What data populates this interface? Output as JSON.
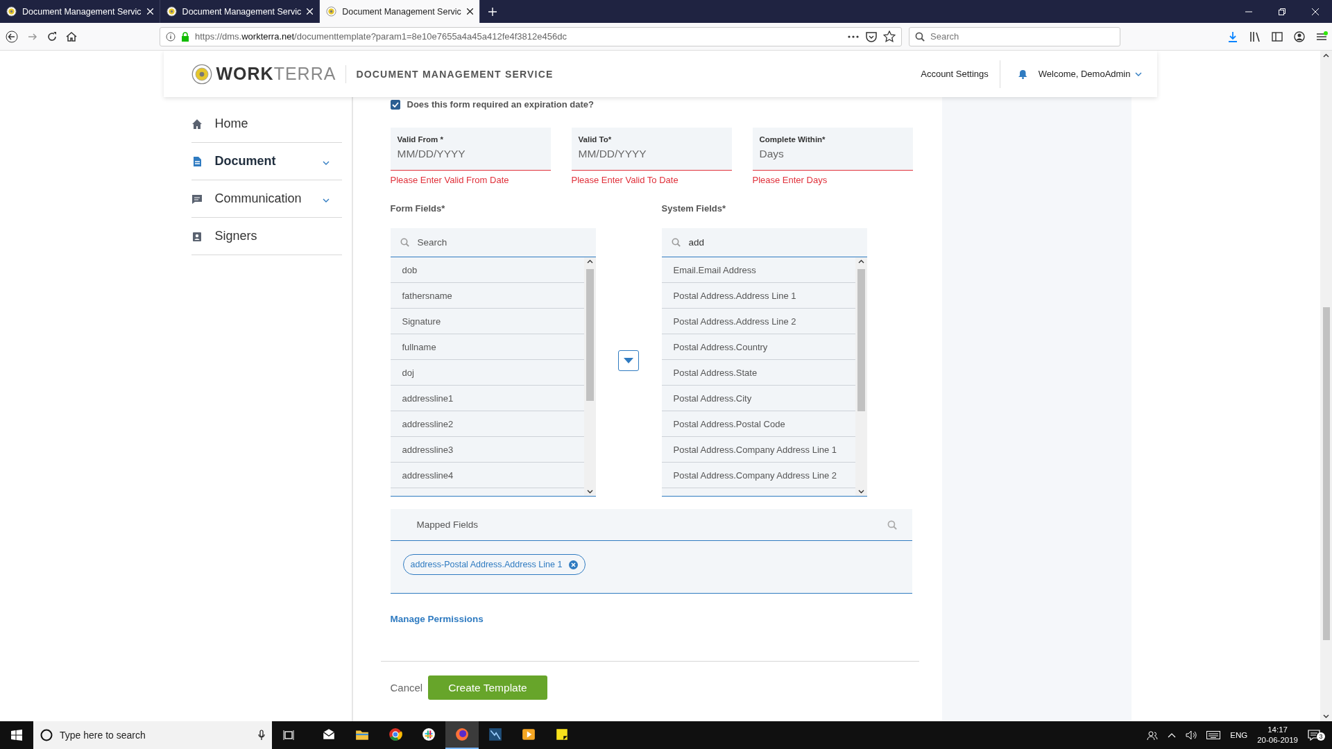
{
  "browser": {
    "tabs": [
      {
        "title": "Document Management Servic",
        "selected": false
      },
      {
        "title": "Document Management Servic",
        "selected": false
      },
      {
        "title": "Document Management Servic",
        "selected": true
      }
    ],
    "url_prefix": "https://dms.",
    "url_domain": "workterra.net",
    "url_path": "/documenttemplate?param1=8e10e7655a4a45a412fe4f3812e456dc",
    "search": {
      "placeholder": "Search"
    }
  },
  "header": {
    "logo_bold": "WORK",
    "logo_light": "TERRA",
    "service": "DOCUMENT MANAGEMENT SERVICE",
    "account_settings": "Account Settings",
    "welcome": "Welcome, DemoAdmin"
  },
  "sidebar": {
    "items": [
      {
        "label": "Home",
        "selected": false,
        "expandable": false
      },
      {
        "label": "Document",
        "selected": true,
        "expandable": true
      },
      {
        "label": "Communication",
        "selected": false,
        "expandable": true
      },
      {
        "label": "Signers",
        "selected": false,
        "expandable": false
      }
    ]
  },
  "form": {
    "expiration": {
      "label": "Does this form required an expiration date?",
      "checked": true
    },
    "date_fields": [
      {
        "label": "Valid From *",
        "placeholder": "MM/DD/YYYY",
        "error": "Please Enter Valid From Date"
      },
      {
        "label": "Valid To*",
        "placeholder": "MM/DD/YYYY",
        "error": "Please Enter Valid To Date"
      },
      {
        "label": "Complete Within*",
        "placeholder": "Days",
        "error": "Please Enter Days"
      }
    ],
    "form_fields": {
      "label": "Form Fields*",
      "search": {
        "placeholder": "Search"
      },
      "items": [
        "dob",
        "fathersname",
        "Signature",
        "fullname",
        "doj",
        "addressline1",
        "addressline2",
        "addressline3",
        "addressline4"
      ]
    },
    "system_fields": {
      "label": "System Fields*",
      "search": {
        "value": "add"
      },
      "items": [
        "Email.Email Address",
        "Postal Address.Address Line 1",
        "Postal Address.Address Line 2",
        "Postal Address.Country",
        "Postal Address.State",
        "Postal Address.City",
        "Postal Address.Postal Code",
        "Postal Address.Company Address Line 1",
        "Postal Address.Company Address Line 2"
      ]
    },
    "mapped": {
      "title": "Mapped Fields",
      "chips": [
        "address-Postal Address.Address Line 1"
      ]
    },
    "manage_permissions": "Manage Permissions",
    "cancel": "Cancel",
    "create": "Create Template"
  },
  "taskbar": {
    "search_placeholder": "Type here to search",
    "apps": [
      {
        "selected": false
      },
      {
        "selected": false
      },
      {
        "selected": false
      },
      {
        "selected": false
      },
      {
        "selected": true
      },
      {
        "selected": false
      },
      {
        "selected": false
      },
      {
        "selected": false
      }
    ],
    "language": "ENG",
    "time": "14:17",
    "date": "20-06-2019",
    "notifications": "3"
  }
}
